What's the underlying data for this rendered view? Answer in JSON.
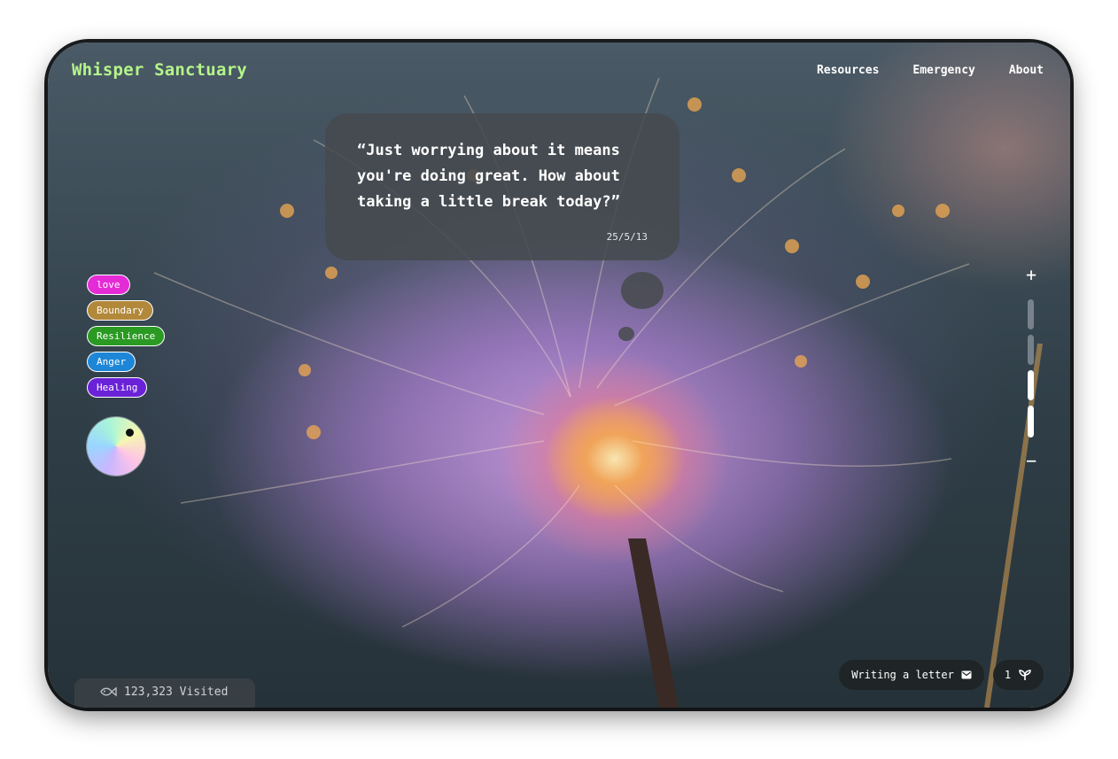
{
  "header": {
    "brand": "Whisper Sanctuary",
    "nav": [
      "Resources",
      "Emergency",
      "About"
    ]
  },
  "message": {
    "quote": "“Just worrying about it means you're doing great. How about taking a little break today?”",
    "date": "25/5/13"
  },
  "tags": [
    {
      "label": "love",
      "color": "#e52bd6"
    },
    {
      "label": "Boundary",
      "color": "#b2883a"
    },
    {
      "label": "Resilience",
      "color": "#2a9a22"
    },
    {
      "label": "Anger",
      "color": "#1e86d6"
    },
    {
      "label": "Healing",
      "color": "#6a22d8"
    }
  ],
  "color_picker": {
    "icon": "color-wheel"
  },
  "zoom": {
    "plus": "+",
    "minus": "−",
    "level": 2,
    "levels": 4
  },
  "footer": {
    "visits": "123,323 Visited",
    "visits_icon": "fish-icon",
    "write_label": "Writing a letter",
    "write_icon": "mail-icon",
    "sprout_count": "1",
    "sprout_icon": "sprout-icon"
  }
}
